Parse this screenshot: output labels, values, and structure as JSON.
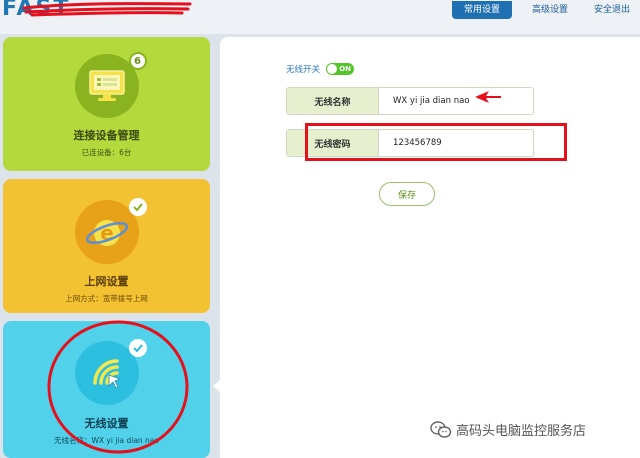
{
  "header": {
    "logo": "FAST",
    "nav": [
      {
        "label": "常用设置",
        "active": true
      },
      {
        "label": "高级设置",
        "active": false
      },
      {
        "label": "安全退出",
        "active": false
      }
    ]
  },
  "cards": {
    "devices": {
      "title": "连接设备管理",
      "subtitle": "已连设备：6台",
      "badge": "6",
      "color": "#b3d93c"
    },
    "internet": {
      "title": "上网设置",
      "subtitle": "上网方式：宽带拨号上网",
      "color": "#f2c232"
    },
    "wireless": {
      "title": "无线设置",
      "subtitle": "无线名称：WX yi jia dian nao",
      "color": "#52d2ea"
    }
  },
  "wireless_form": {
    "switch_label": "无线开关",
    "switch_state": "ON",
    "name_label": "无线名称",
    "name_value": "WX yi jia dian nao",
    "password_label": "无线密码",
    "password_value": "123456789",
    "save_label": "保存"
  },
  "watermark": "高码头电脑监控服务店",
  "colors": {
    "accent": "#1f6fb3",
    "annotation_red": "#e5101c",
    "toggle_green": "#55c42b"
  }
}
